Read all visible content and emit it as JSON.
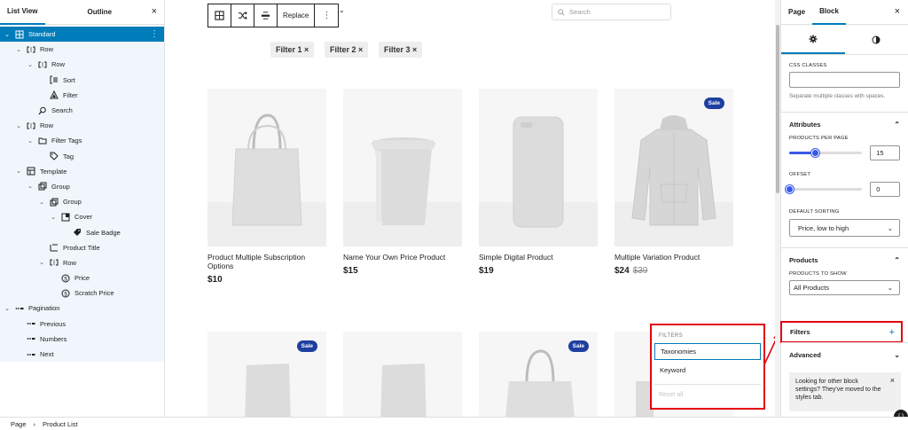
{
  "list_view": {
    "tabs": [
      "List View",
      "Outline"
    ],
    "close_label": "×",
    "tree": [
      {
        "label": "Standard",
        "level": 0,
        "icon": "grid-icon",
        "expanded": true,
        "selected": true
      },
      {
        "label": "Row",
        "level": 1,
        "icon": "row-icon",
        "expanded": true
      },
      {
        "label": "Row",
        "level": 2,
        "icon": "row-icon",
        "expanded": true
      },
      {
        "label": "Sort",
        "level": 3,
        "icon": "sort-icon"
      },
      {
        "label": "Filter",
        "level": 3,
        "icon": "filter-icon"
      },
      {
        "label": "Search",
        "level": 2,
        "icon": "search-icon"
      },
      {
        "label": "Row",
        "level": 1,
        "icon": "row-icon",
        "expanded": true
      },
      {
        "label": "Filter Tags",
        "level": 2,
        "icon": "folder-icon",
        "expanded": true
      },
      {
        "label": "Tag",
        "level": 3,
        "icon": "tag-icon"
      },
      {
        "label": "Template",
        "level": 1,
        "icon": "template-icon",
        "expanded": true
      },
      {
        "label": "Group",
        "level": 2,
        "icon": "group-icon",
        "expanded": true
      },
      {
        "label": "Group",
        "level": 3,
        "icon": "group-icon",
        "expanded": true
      },
      {
        "label": "Cover",
        "level": 4,
        "icon": "cover-icon",
        "expanded": true
      },
      {
        "label": "Sale Badge",
        "level": 5,
        "icon": "badge-icon"
      },
      {
        "label": "Product Title",
        "level": 3,
        "icon": "title-icon"
      },
      {
        "label": "Row",
        "level": 3,
        "icon": "row-icon",
        "expanded": true
      },
      {
        "label": "Price",
        "level": 4,
        "icon": "price-icon"
      },
      {
        "label": "Scratch Price",
        "level": 4,
        "icon": "price-icon"
      },
      {
        "label": "Pagination",
        "level": 0,
        "icon": "pagination-icon",
        "expanded": true
      },
      {
        "label": "Previous",
        "level": 1,
        "icon": "pagination-icon"
      },
      {
        "label": "Numbers",
        "level": 1,
        "icon": "pagination-icon"
      },
      {
        "label": "Next",
        "level": 1,
        "icon": "pagination-icon"
      }
    ]
  },
  "toolbar": {
    "replace_label": "Replace",
    "more_label": "⋮",
    "chevron": "⌄"
  },
  "search": {
    "placeholder": "Search"
  },
  "filters": [
    "Filter 1 ×",
    "Filter 2 ×",
    "Filter 3 ×"
  ],
  "products": [
    {
      "name": "Product Multiple Subscription Options",
      "price": "$10",
      "old_price": "",
      "sale": false,
      "image": "tote-bag"
    },
    {
      "name": "Name Your Own Price Product",
      "price": "$15",
      "old_price": "",
      "sale": false,
      "image": "coffee-cup"
    },
    {
      "name": "Simple Digital Product",
      "price": "$19",
      "old_price": "",
      "sale": false,
      "image": "phone-case"
    },
    {
      "name": "Multiple Variation Product",
      "price": "$24",
      "old_price": "$39",
      "sale": true,
      "image": "hoodie"
    }
  ],
  "second_row_sales": [
    true,
    false,
    true,
    false
  ],
  "sale_label": "Sale",
  "filters_popover": {
    "title": "FILTERS",
    "items": [
      "Taxonomies",
      "Keyword"
    ],
    "reset": "Reset all"
  },
  "settings": {
    "tabs": [
      "Page",
      "Block"
    ],
    "close_label": "×",
    "css_classes_label": "CSS CLASSES",
    "css_classes_value": "",
    "css_help": "Separate multiple classes with spaces.",
    "attributes_title": "Attributes",
    "products_per_page_label": "PRODUCTS PER PAGE",
    "products_per_page": "15",
    "products_per_page_fraction": 0.35,
    "offset_label": "OFFSET",
    "offset": "0",
    "offset_fraction": 0.0,
    "default_sorting_label": "DEFAULT SORTING",
    "default_sorting": "Price, low to high",
    "products_title": "Products",
    "products_to_show_label": "PRODUCTS TO SHOW",
    "products_to_show": "All Products",
    "filters_title": "Filters",
    "filters_add": "+",
    "advanced_title": "Advanced",
    "notice": "Looking for other block settings? They've moved to the styles tab.",
    "notice_close": "×"
  },
  "fab_label": "{ }",
  "breadcrumb": [
    "Page",
    "Product List"
  ],
  "breadcrumb_sep": "›"
}
